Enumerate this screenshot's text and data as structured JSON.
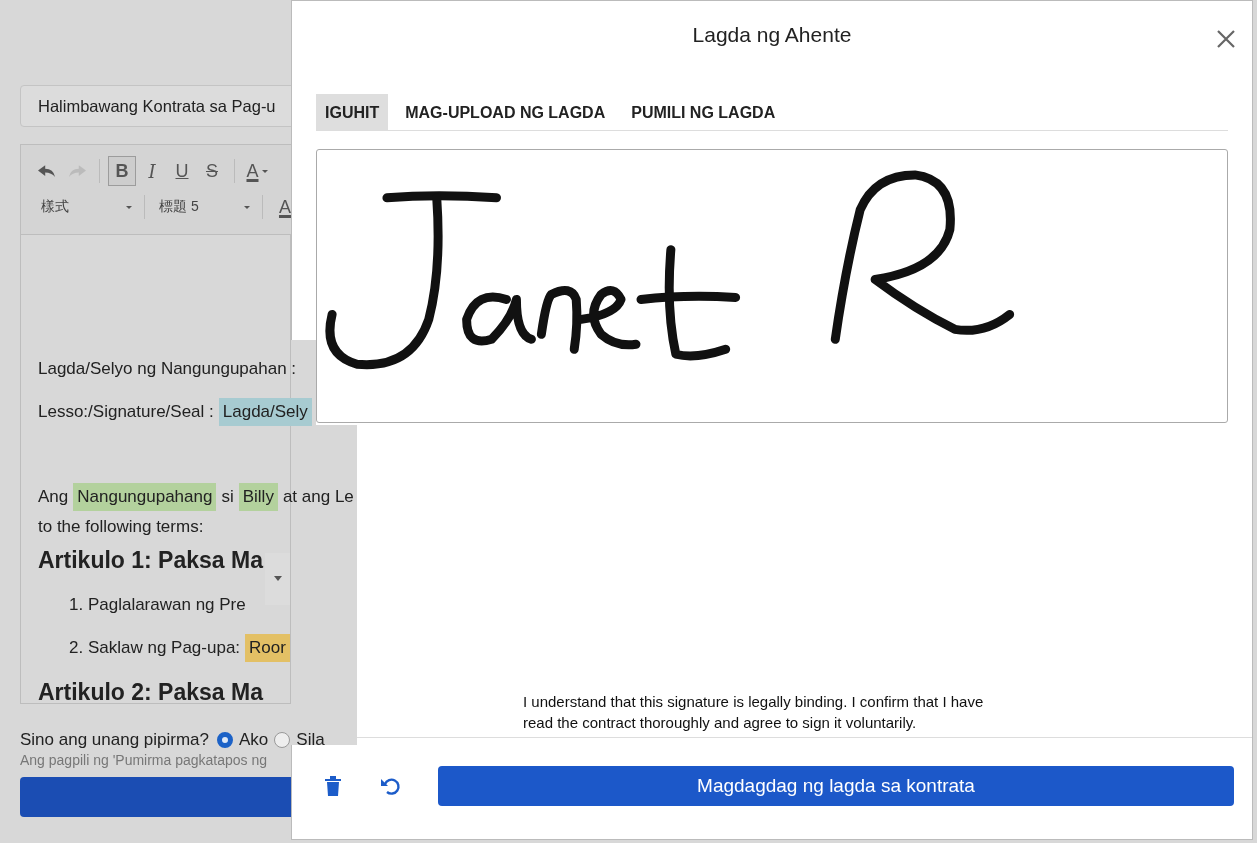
{
  "document": {
    "title_field": "Halimbawang Kontrata sa Pag-u",
    "toolbar_row_1": [
      {
        "kind": "undo"
      },
      {
        "kind": "redo"
      },
      {
        "kind": "bold",
        "label": "B",
        "on": true
      },
      {
        "kind": "italic",
        "label": "I",
        "on": false
      },
      {
        "kind": "underline",
        "label": "U",
        "on": false
      },
      {
        "kind": "strike",
        "label": "S",
        "on": false
      },
      {
        "kind": "color",
        "label": "A"
      }
    ],
    "toolbar_row_2": [
      {
        "kind": "select",
        "label": "樣式"
      },
      {
        "kind": "select",
        "label": "標題 5"
      },
      {
        "kind": "color",
        "label": "A"
      }
    ],
    "content": [
      {
        "kind": "line",
        "segments": [
          {
            "text": "Lagda/Selyo ng Nangungupahan :"
          }
        ]
      },
      {
        "kind": "line",
        "segments": [
          {
            "text": "Lesso:/Signature/Seal :"
          },
          {
            "text": "Lagda/Sely",
            "color": "#a7cbd1"
          }
        ]
      },
      {
        "kind": "gap"
      },
      {
        "kind": "line",
        "segments": [
          {
            "text": "Ang"
          },
          {
            "text": "Nangungupahang",
            "color": "#b3d19d"
          },
          {
            "text": "si"
          },
          {
            "text": "Billy",
            "color": "#b3d19d"
          },
          {
            "text": "at ang Le"
          }
        ]
      },
      {
        "kind": "line",
        "segments": [
          {
            "text": "to the following terms:"
          }
        ]
      },
      {
        "kind": "heading",
        "text": "Artikulo 1: Paksa Ma"
      },
      {
        "kind": "item",
        "segments": [
          {
            "text": "1. Paglalarawan ng Pre"
          }
        ]
      },
      {
        "kind": "item",
        "segments": [
          {
            "text": "2. Saklaw ng Pag-upa:"
          },
          {
            "text": "Roor",
            "color": "#e3c065"
          }
        ]
      },
      {
        "kind": "heading",
        "text": "Artikulo 2: Paksa Ma"
      }
    ]
  },
  "signer_question": {
    "label": "Sino ang unang pipirma?",
    "options": [
      {
        "label": "Ako",
        "selected": true
      },
      {
        "label": "Sila",
        "selected": false
      }
    ],
    "hint": "Ang pagpili ng 'Pumirma pagkatapos ng"
  },
  "modal": {
    "title": "Lagda ng Ahente",
    "tabs": [
      {
        "label": "IGUHIT",
        "selected": true
      },
      {
        "label": "MAG-UPLOAD NG LAGDA",
        "selected": false
      },
      {
        "label": "PUMILI NG LAGDA",
        "selected": false
      }
    ],
    "disclaimer": "I understand that this signature is legally binding. I confirm that I have read the contract thoroughly and agree to sign it voluntarily.",
    "submit_button": "Magdagdag ng lagda sa kontrata"
  }
}
